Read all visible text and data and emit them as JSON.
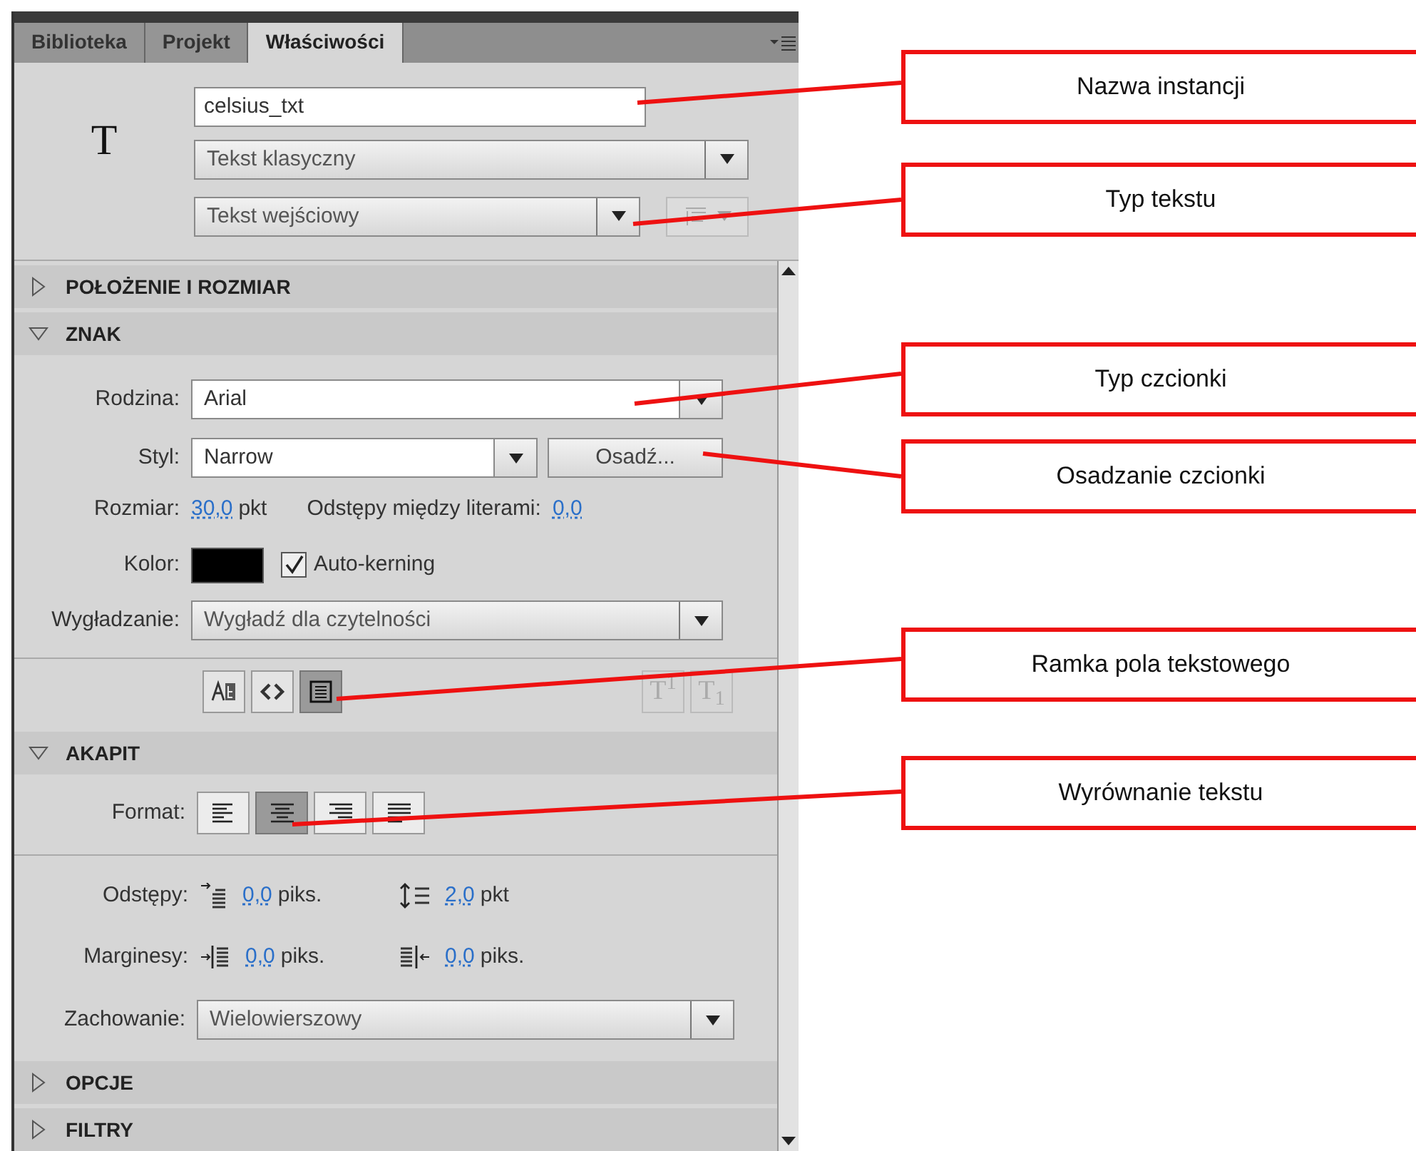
{
  "tabs": [
    {
      "label": "Biblioteka",
      "selected": false
    },
    {
      "label": "Projekt",
      "selected": false
    },
    {
      "label": "Właściwości",
      "selected": true
    }
  ],
  "header": {
    "symbol": "T",
    "instance_name": "celsius_txt",
    "text_engine": "Tekst klasyczny",
    "text_type": "Tekst wejściowy",
    "orientation_disabled": true
  },
  "sections": [
    {
      "title": "POŁOŻENIE I ROZMIAR",
      "expanded": false
    },
    {
      "kind": "character",
      "title": "ZNAK",
      "expanded": true,
      "family": {
        "label": "Rodzina:",
        "value": "Arial"
      },
      "style": {
        "label": "Styl:",
        "value": "Narrow"
      },
      "embed_button": "Osadź...",
      "size": {
        "label": "Rozmiar:",
        "value": "30,0",
        "unit": "pkt"
      },
      "letter_spacing": {
        "label": "Odstępy między literami:",
        "value": "0,0"
      },
      "color": {
        "label": "Kolor:",
        "color": "#000000"
      },
      "auto_kerning": {
        "label": "Auto-kerning",
        "checked": true
      },
      "antialias": {
        "label": "Wygładzanie:",
        "value": "Wygładź dla czytelności"
      },
      "text_buttons": [
        {
          "kind": "selectable",
          "selected": false
        },
        {
          "kind": "html",
          "selected": false
        },
        {
          "kind": "border",
          "selected": true
        }
      ],
      "script_buttons": [
        {
          "label": "T$^{1}$",
          "disabled": true
        },
        {
          "label": "T$_{1}$",
          "disabled": true
        }
      ]
    },
    {
      "kind": "paragraph",
      "title": "AKAPIT",
      "expanded": true,
      "format_label": "Format:",
      "align_buttons": [
        {
          "kind": "left",
          "selected": false
        },
        {
          "kind": "center",
          "selected": true
        },
        {
          "kind": "right",
          "selected": false
        },
        {
          "kind": "justify",
          "selected": false
        }
      ],
      "spacing": {
        "label": "Odstępy:",
        "items": [
          {
            "kind": "indent",
            "value": "0,0",
            "unit": "piks."
          },
          {
            "kind": "line",
            "value": "2,0",
            "unit": "pkt"
          }
        ]
      },
      "margins": {
        "label": "Marginesy:",
        "items": [
          {
            "kind": "left",
            "value": "0,0",
            "unit": "piks."
          },
          {
            "kind": "right",
            "value": "0,0",
            "unit": "piks."
          }
        ]
      },
      "behavior": {
        "label": "Zachowanie:",
        "value": "Wielowierszowy"
      }
    },
    {
      "title": "OPCJE",
      "expanded": false
    },
    {
      "title": "FILTRY",
      "expanded": false
    }
  ],
  "callouts": [
    {
      "text": "Nazwa instancji"
    },
    {
      "text": "Typ tekstu"
    },
    {
      "text": "Typ czcionki"
    },
    {
      "text": "Osadzanie czcionki"
    },
    {
      "text": "Ramka pola tekstowego"
    },
    {
      "text": "Wyrównanie tekstu"
    }
  ]
}
